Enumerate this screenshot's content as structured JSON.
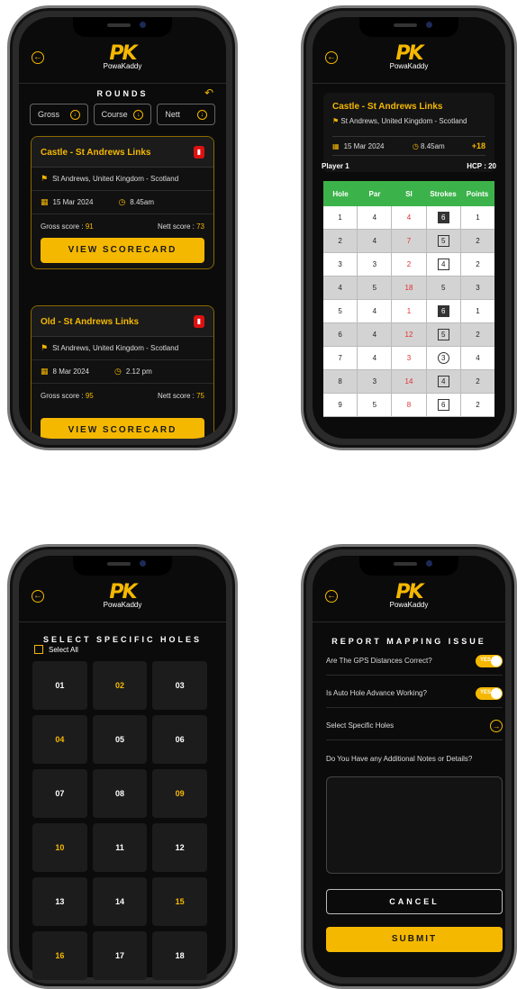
{
  "brand": {
    "logo_mark": "PK",
    "logo_name": "PowaKaddy",
    "accent": "#f5b800"
  },
  "rounds": {
    "title": "ROUNDS",
    "filters": [
      {
        "label": "Gross"
      },
      {
        "label": "Course"
      },
      {
        "label": "Nett"
      }
    ],
    "cards": [
      {
        "title": "Castle - St Andrews Links",
        "location": "St Andrews, United Kingdom - Scotland",
        "date": "15 Mar 2024",
        "time": "8.45am",
        "gross_label": "Gross score :",
        "gross": "91",
        "nett_label": "Nett score :",
        "nett": "73",
        "button": "VIEW SCORECARD"
      },
      {
        "title": "Old - St Andrews Links",
        "location": "St Andrews, United Kingdom - Scotland",
        "date": "8 Mar 2024",
        "time": "2.12 pm",
        "gross_label": "Gross score :",
        "gross": "95",
        "nett_label": "Nett score :",
        "nett": "75",
        "button": "VIEW SCORECARD"
      }
    ]
  },
  "scorecard": {
    "title": "Castle - St Andrews Links",
    "location": "St Andrews, United Kingdom - Scotland",
    "date": "15 Mar 2024",
    "time": "8.45am",
    "diff": "+18",
    "player": "Player 1",
    "hcp": "HCP : 20",
    "headers": [
      "Hole",
      "Par",
      "SI",
      "Strokes",
      "Points"
    ],
    "rows": [
      {
        "hole": "1",
        "par": "4",
        "si": "4",
        "strokes": "6",
        "style": "dark",
        "points": "1"
      },
      {
        "hole": "2",
        "par": "4",
        "si": "7",
        "strokes": "5",
        "style": "box",
        "points": "2"
      },
      {
        "hole": "3",
        "par": "3",
        "si": "2",
        "strokes": "4",
        "style": "box",
        "points": "2"
      },
      {
        "hole": "4",
        "par": "5",
        "si": "18",
        "strokes": "5",
        "style": "plain",
        "points": "3"
      },
      {
        "hole": "5",
        "par": "4",
        "si": "1",
        "strokes": "6",
        "style": "dark",
        "points": "1"
      },
      {
        "hole": "6",
        "par": "4",
        "si": "12",
        "strokes": "5",
        "style": "box",
        "points": "2"
      },
      {
        "hole": "7",
        "par": "4",
        "si": "3",
        "strokes": "3",
        "style": "circ",
        "points": "4"
      },
      {
        "hole": "8",
        "par": "3",
        "si": "14",
        "strokes": "4",
        "style": "box",
        "points": "2"
      },
      {
        "hole": "9",
        "par": "5",
        "si": "8",
        "strokes": "6",
        "style": "box",
        "points": "2"
      }
    ]
  },
  "select_holes": {
    "title": "SELECT SPECIFIC HOLES",
    "select_all": "Select All",
    "holes": [
      {
        "n": "01",
        "sel": false
      },
      {
        "n": "02",
        "sel": true
      },
      {
        "n": "03",
        "sel": false
      },
      {
        "n": "04",
        "sel": true
      },
      {
        "n": "05",
        "sel": false
      },
      {
        "n": "06",
        "sel": false
      },
      {
        "n": "07",
        "sel": false
      },
      {
        "n": "08",
        "sel": false
      },
      {
        "n": "09",
        "sel": true
      },
      {
        "n": "10",
        "sel": true
      },
      {
        "n": "11",
        "sel": false
      },
      {
        "n": "12",
        "sel": false
      },
      {
        "n": "13",
        "sel": false
      },
      {
        "n": "14",
        "sel": false
      },
      {
        "n": "15",
        "sel": true
      },
      {
        "n": "16",
        "sel": true
      },
      {
        "n": "17",
        "sel": false
      },
      {
        "n": "18",
        "sel": false
      }
    ]
  },
  "report": {
    "title": "REPORT MAPPING ISSUE",
    "q1": "Are The GPS Distances Correct?",
    "q2": "Is Auto Hole Advance Working?",
    "q3": "Select Specific Holes",
    "q4": "Do You Have any Additional Notes or Details?",
    "toggle_label": "YES",
    "cancel": "CANCEL",
    "submit": "SUBMIT"
  }
}
